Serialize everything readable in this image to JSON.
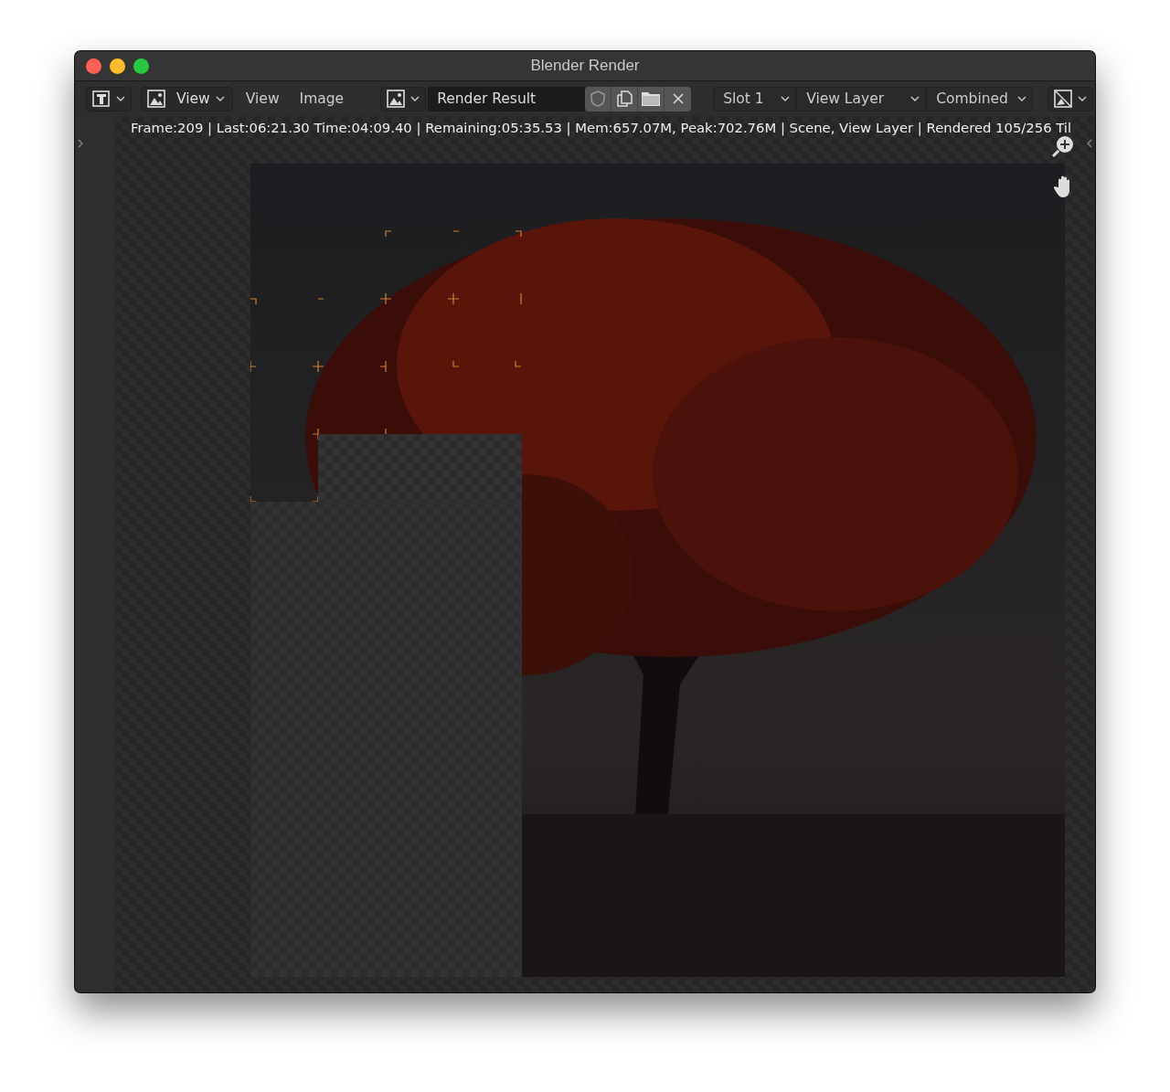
{
  "window": {
    "title": "Blender Render"
  },
  "toolbar": {
    "view_mode": "View",
    "menus": [
      "View",
      "Image"
    ],
    "image_name": "Render Result",
    "dropdowns": [
      "Slot 1",
      "View Layer",
      "Combined"
    ]
  },
  "status_text": "Frame:209 | Last:06:21.30 Time:04:09.40 | Remaining:05:35.53 | Mem:657.07M, Peak:702.76M | Scene, View Layer | Rendered 105/256 Til"
}
